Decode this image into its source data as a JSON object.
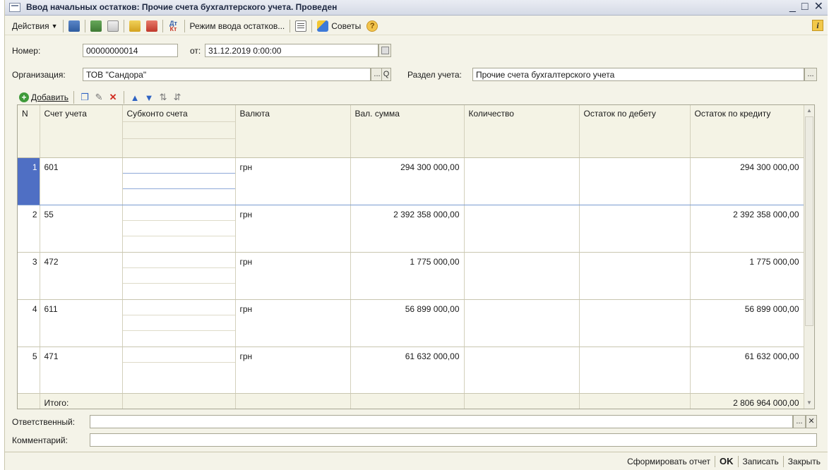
{
  "window": {
    "title": "Ввод начальных остатков: Прочие счета бухгалтерского учета. Проведен",
    "minimize": "_",
    "maximize": "□",
    "close": "✕"
  },
  "toolbar": {
    "actions_label": "Действия",
    "mode_label": "Режим ввода остатков...",
    "tips_label": "Советы",
    "help_glyph": "?",
    "info_glyph": "i",
    "dtkt_top": "Дт",
    "dtkt_bottom": "Кт"
  },
  "form": {
    "number_label": "Номер:",
    "number_value": "00000000014",
    "from_label": "от:",
    "date_value": "31.12.2019 0:00:00",
    "org_label": "Организация:",
    "org_value": "ТОВ \"Сандора\"",
    "section_label": "Раздел учета:",
    "section_value": "Прочие счета бухгалтерского учета",
    "responsible_label": "Ответственный:",
    "responsible_value": "",
    "comment_label": "Комментарий:",
    "comment_value": "",
    "select_btn": "...",
    "search_btn": "Q",
    "clear_btn": "✕"
  },
  "grid_toolbar": {
    "add_label": "Добавить",
    "add_glyph": "+"
  },
  "table": {
    "headers": {
      "n": "N",
      "account": "Счет учета",
      "subconto": "Субконто счета",
      "currency": "Валюта",
      "cur_sum": "Вал. сумма",
      "quantity": "Количество",
      "debit": "Остаток по дебету",
      "credit": "Остаток по кредиту"
    },
    "rows": [
      {
        "n": "1",
        "account": "601",
        "currency": "грн",
        "cur_sum": "294 300 000,00",
        "quantity": "",
        "debit": "",
        "credit": "294 300 000,00"
      },
      {
        "n": "2",
        "account": "55",
        "currency": "грн",
        "cur_sum": "2 392 358 000,00",
        "quantity": "",
        "debit": "",
        "credit": "2 392 358 000,00"
      },
      {
        "n": "3",
        "account": "472",
        "currency": "грн",
        "cur_sum": "1 775 000,00",
        "quantity": "",
        "debit": "",
        "credit": "1 775 000,00"
      },
      {
        "n": "4",
        "account": "611",
        "currency": "грн",
        "cur_sum": "56 899 000,00",
        "quantity": "",
        "debit": "",
        "credit": "56 899 000,00"
      },
      {
        "n": "5",
        "account": "471",
        "currency": "грн",
        "cur_sum": "61 632 000,00",
        "quantity": "",
        "debit": "",
        "credit": "61 632 000,00"
      }
    ],
    "total_label": "Итого:",
    "total_credit": "2 806 964 000,00"
  },
  "statusbar": {
    "report_label": "Сформировать отчет",
    "ok_label": "OK",
    "save_label": "Записать",
    "close_label": "Закрыть"
  }
}
